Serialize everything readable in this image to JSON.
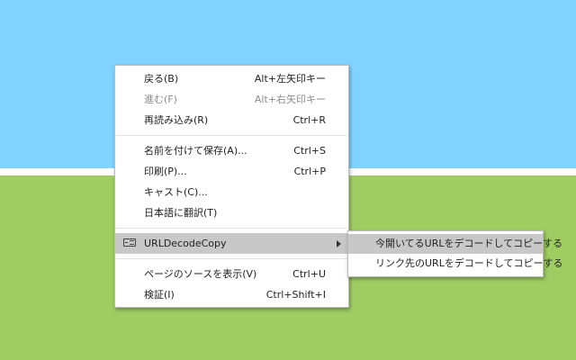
{
  "context_menu": {
    "back": {
      "label": "戻る(B)",
      "shortcut": "Alt+左矢印キー"
    },
    "forward": {
      "label": "進む(F)",
      "shortcut": "Alt+右矢印キー"
    },
    "reload": {
      "label": "再読み込み(R)",
      "shortcut": "Ctrl+R"
    },
    "save_as": {
      "label": "名前を付けて保存(A)...",
      "shortcut": "Ctrl+S"
    },
    "print": {
      "label": "印刷(P)...",
      "shortcut": "Ctrl+P"
    },
    "cast": {
      "label": "キャスト(C)..."
    },
    "translate": {
      "label": "日本語に翻訳(T)"
    },
    "extension": {
      "label": "URLDecodeCopy",
      "icon": "extension-icon"
    },
    "view_source": {
      "label": "ページのソースを表示(V)",
      "shortcut": "Ctrl+U"
    },
    "inspect": {
      "label": "検証(I)",
      "shortcut": "Ctrl+Shift+I"
    }
  },
  "submenu": {
    "copy_current_url": {
      "label": "今開いてるURLをデコードしてコピーする"
    },
    "copy_link_url": {
      "label": "リンク先のURLをデコードしてコピーする"
    }
  },
  "colors": {
    "sky": "#80d3fe",
    "stripe": "#ffffff",
    "grass": "#9fcd62",
    "highlight": "#c8c8c8"
  }
}
